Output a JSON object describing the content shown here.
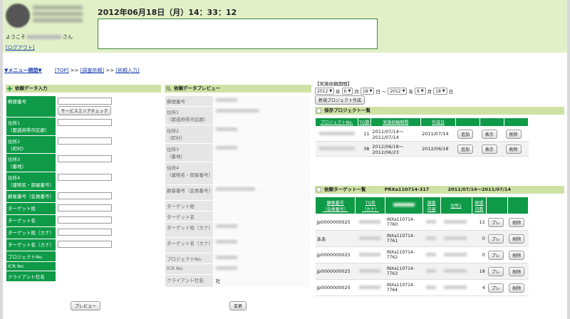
{
  "header": {
    "datetime": "2012年06月18日（月）14：33：12",
    "welcome_prefix": "ようこそ",
    "welcome_suffix": "さん",
    "logout_label": "[ログアウト]"
  },
  "nav": {
    "menu_toggle": "▼メニュー開閉▼",
    "crumb_top": "[TOP]",
    "crumb_sep1": " >> ",
    "crumb_survey": "[調査依頼]",
    "crumb_sep2": " >> ",
    "crumb_input": "[依頼入力]"
  },
  "input_panel": {
    "title": "依頼データ入力",
    "service_check_label": "サービスエリアチェック",
    "preview_label": "プレビュー",
    "rows": [
      {
        "label": "郵便番号"
      },
      {
        "label": "住所1\n（都道府県市区郡）"
      },
      {
        "label": "住所2\n（町村）"
      },
      {
        "label": "住所3\n（番地）"
      },
      {
        "label": "住所4\n（建物名・部屋番号）"
      },
      {
        "label": "顧客番号（会員番号）"
      },
      {
        "label": "ターゲット姓"
      },
      {
        "label": "ターゲット名"
      },
      {
        "label": "ターゲット姓（カナ）"
      },
      {
        "label": "ターゲット名（カナ）"
      },
      {
        "label": "プロジェクトNo."
      },
      {
        "label": "ICR No."
      },
      {
        "label": "クライアント社名"
      }
    ]
  },
  "preview_panel": {
    "title": "依頼データプレビュー",
    "change_label": "変更",
    "client_suffix": "社",
    "rows": [
      {
        "label": "郵便番号"
      },
      {
        "label": "住所1\n（都道府県市区郡）"
      },
      {
        "label": "住所2\n（町村）"
      },
      {
        "label": "住所3\n（番地）"
      },
      {
        "label": "住所4\n（建物名・部屋番号）"
      },
      {
        "label": "顧客番号（会員番号）"
      },
      {
        "label": "ターゲット姓"
      },
      {
        "label": "ターゲット名"
      },
      {
        "label": "ターゲット姓（カナ）"
      },
      {
        "label": "ターゲット名（カナ）"
      },
      {
        "label": "プロジェクトNo."
      },
      {
        "label": "ICR No."
      },
      {
        "label": "クライアント社名"
      }
    ]
  },
  "period": {
    "label": "【実施依頼期間】",
    "start_year": "2012",
    "year_unit": "年",
    "start_month": "6",
    "month_unit": "月",
    "start_day": "18",
    "day_unit": "日",
    "tilde": "～",
    "end_year": "2012",
    "end_month": "6",
    "end_day": "18",
    "new_project_label": "新規プロジェクト作成"
  },
  "saved_projects": {
    "title": "保存プロジェクト一覧",
    "columns": [
      "プロジェクトNo.",
      "TG数",
      "実施依頼期間",
      "作成日"
    ],
    "add_label": "追加",
    "show_label": "表示",
    "delete_label": "削除",
    "rows": [
      {
        "tg": "11",
        "period": "2011/07/14～2011/07/14",
        "created": "2011/07/14"
      },
      {
        "tg": "38",
        "period": "2012/06/18～2012/06/23",
        "created": "2012/06/18"
      }
    ]
  },
  "targets": {
    "title": "依頼ターゲット一覧",
    "project_code": "PRXa110714-317",
    "project_period": "2011/07/14～2011/07/14",
    "columns": [
      "顧客番号\n（会員番号）",
      "TG名\n（カナ）",
      "",
      "調査\n内容",
      "住所1",
      "経過\n月数"
    ],
    "pre_label": "プレ",
    "delete_label": "削除",
    "rows": [
      {
        "customer": "jp0000000025",
        "icr": "INXa110714-7760",
        "months": "11"
      },
      {
        "customer": "ああ",
        "icr": "INXa110714-7761",
        "months": "0"
      },
      {
        "customer": "jp0000000025",
        "icr": "INXa110714-7762",
        "months": "0"
      },
      {
        "customer": "jp0000000025",
        "icr": "INXa110714-7763",
        "months": "18"
      },
      {
        "customer": "jp0000000025",
        "icr": "INXa110714-7764",
        "months": "4"
      }
    ]
  },
  "colors": {
    "header_bg": "#e2f0c8",
    "panel_head": "#cfe2a4",
    "accent_green": "#0e9a47",
    "link_blue": "#1a3fb0"
  }
}
